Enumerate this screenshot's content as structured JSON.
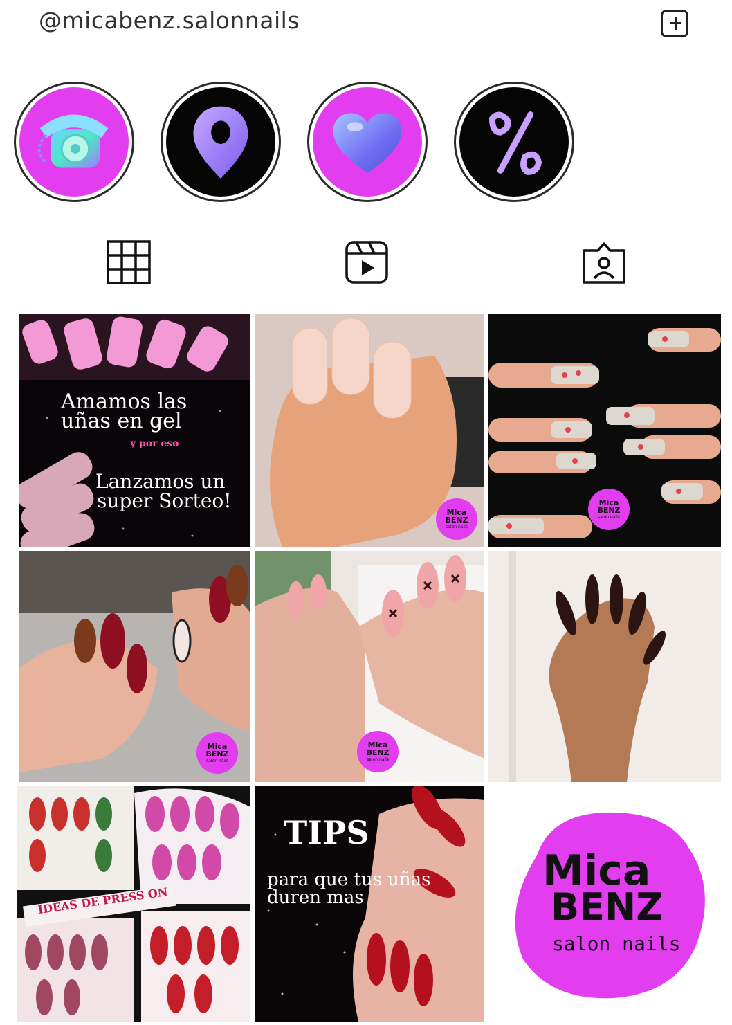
{
  "header": {
    "username": "@micabenz.salonnails"
  },
  "highlights": [
    {
      "icon": "telephone-icon",
      "bg": "#e23ef0"
    },
    {
      "icon": "location-pin-icon",
      "bg": "#050505"
    },
    {
      "icon": "heart-icon",
      "bg": "#e23ef0"
    },
    {
      "icon": "percent-icon",
      "bg": "#050505"
    }
  ],
  "tabs": [
    {
      "icon": "grid-icon"
    },
    {
      "icon": "reels-icon"
    },
    {
      "icon": "tagged-icon"
    }
  ],
  "posts": {
    "p1": {
      "line1": "Amamos las",
      "line2": "uñas en gel",
      "line3": "y por eso",
      "line4": "Lanzamos un",
      "line5": "super Sorteo!"
    },
    "badge": {
      "line1": "Mica",
      "line2": "BENZ",
      "line3": "salon nails"
    },
    "p8": {
      "line1": "TIPS",
      "line2": "para que tus uñas",
      "line3": "duren mas"
    },
    "p7": {
      "label": "IDEAS DE PRESS ON"
    },
    "p9": {
      "line1": "Mica",
      "line2": "BENZ",
      "line3": "salon nails"
    }
  },
  "colors": {
    "brand_pink": "#e23ef0",
    "dark": "#050505"
  }
}
